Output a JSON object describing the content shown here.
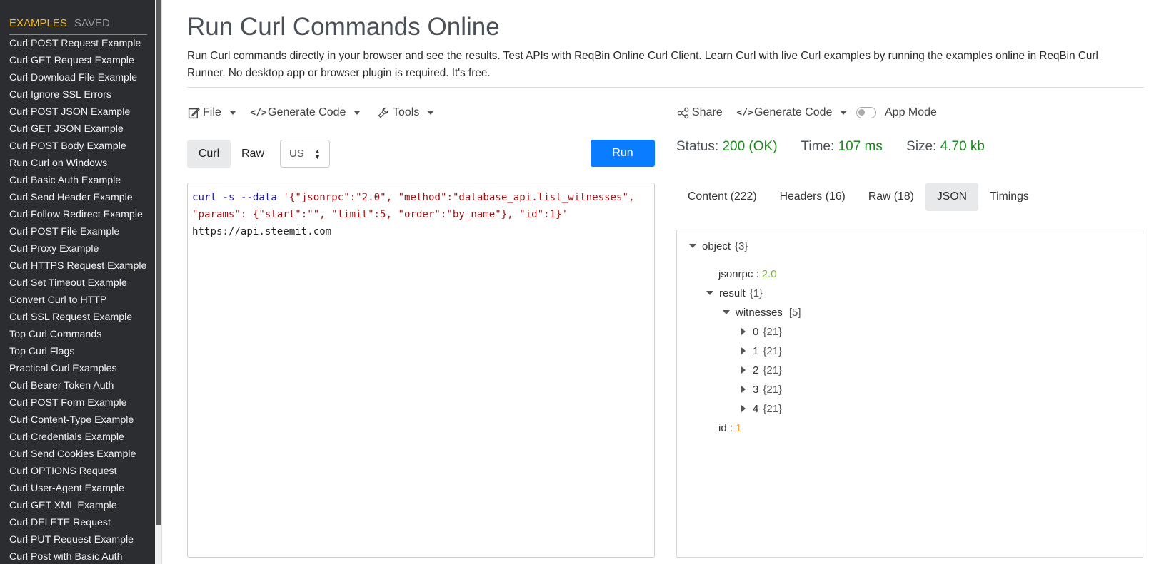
{
  "sidebar": {
    "tab_examples": "EXAMPLES",
    "tab_saved": "SAVED",
    "items": [
      "Curl POST Request Example",
      "Curl GET Request Example",
      "Curl Download File Example",
      "Curl Ignore SSL Errors",
      "Curl POST JSON Example",
      "Curl GET JSON Example",
      "Curl POST Body Example",
      "Run Curl on Windows",
      "Curl Basic Auth Example",
      "Curl Send Header Example",
      "Curl Follow Redirect Example",
      "Curl POST File Example",
      "Curl Proxy Example",
      "Curl HTTPS Request Example",
      "Curl Set Timeout Example",
      "Convert Curl to HTTP",
      "Curl SSL Request Example",
      "Top Curl Commands",
      "Top Curl Flags",
      "Practical Curl Examples",
      "Curl Bearer Token Auth",
      "Curl POST Form Example",
      "Curl Content-Type Example",
      "Curl Credentials Example",
      "Curl Send Cookies Example",
      "Curl OPTIONS Request",
      "Curl User-Agent Example",
      "Curl GET XML Example",
      "Curl DELETE Request",
      "Curl PUT Request Example",
      "Curl Post with Basic Auth"
    ]
  },
  "header": {
    "title": "Run Curl Commands Online",
    "description": "Run Curl commands directly in your browser and see the results. Test APIs with ReqBin Online Curl Client. Learn Curl with live Curl examples by running the examples online in ReqBin Curl Runner. No desktop app or browser plugin is required. It's free."
  },
  "toolbar": {
    "file": "File",
    "generate_code": "Generate Code",
    "tools": "Tools",
    "share": "Share",
    "generate_code_right": "Generate Code",
    "app_mode": "App Mode"
  },
  "request": {
    "mode_curl": "Curl",
    "mode_raw": "Raw",
    "region": "US",
    "run": "Run",
    "code": {
      "cmd": "curl",
      "flag_s": "-s",
      "flag_data": "--data",
      "payload_line1": "'{\"jsonrpc\":\"2.0\", \"method\":\"database_api.list_witnesses\",",
      "payload_line2": "\"params\": {\"start\":\"\", \"limit\":5, \"order\":\"by_name\"}, \"id\":1}'",
      "url": "https://api.steemit.com"
    }
  },
  "response": {
    "status_label": "Status:",
    "status_value": "200 (OK)",
    "time_label": "Time:",
    "time_value": "107 ms",
    "size_label": "Size:",
    "size_value": "4.70 kb",
    "tabs": [
      "Content (222)",
      "Headers (16)",
      "Raw (18)",
      "JSON",
      "Timings"
    ],
    "active_tab": "JSON",
    "json": {
      "root_key": "object",
      "root_meta": "{3}",
      "jsonrpc_key": "jsonrpc :",
      "jsonrpc_val": "2.0",
      "result_key": "result",
      "result_meta": "{1}",
      "witnesses_key": "witnesses",
      "witnesses_meta": "[5]",
      "items": [
        {
          "key": "0",
          "meta": "{21}"
        },
        {
          "key": "1",
          "meta": "{21}"
        },
        {
          "key": "2",
          "meta": "{21}"
        },
        {
          "key": "3",
          "meta": "{21}"
        },
        {
          "key": "4",
          "meta": "{21}"
        }
      ],
      "id_key": "id :",
      "id_val": "1"
    }
  }
}
